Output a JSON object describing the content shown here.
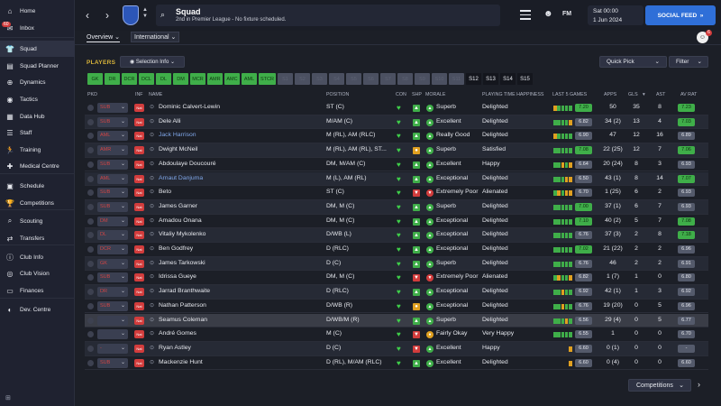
{
  "sidebar": {
    "items": [
      {
        "label": "Home",
        "icon": "home-icon",
        "glyph": "⌂"
      },
      {
        "label": "Inbox",
        "icon": "inbox-icon",
        "glyph": "✉",
        "badge": "60"
      },
      {
        "label": "Squad",
        "icon": "squad-icon",
        "glyph": "👕"
      },
      {
        "label": "Squad Planner",
        "icon": "planner-icon",
        "glyph": "▤"
      },
      {
        "label": "Dynamics",
        "icon": "dynamics-icon",
        "glyph": "⊕"
      },
      {
        "label": "Tactics",
        "icon": "tactics-icon",
        "glyph": "◉"
      },
      {
        "label": "Data Hub",
        "icon": "data-hub-icon",
        "glyph": "▦"
      },
      {
        "label": "Staff",
        "icon": "staff-icon",
        "glyph": "☰"
      },
      {
        "label": "Training",
        "icon": "training-icon",
        "glyph": "🏃"
      },
      {
        "label": "Medical Centre",
        "icon": "medical-icon",
        "glyph": "✚"
      },
      {
        "label": "Schedule",
        "icon": "schedule-icon",
        "glyph": "▣"
      },
      {
        "label": "Competitions",
        "icon": "trophy-icon",
        "glyph": "🏆"
      },
      {
        "label": "Scouting",
        "icon": "scouting-icon",
        "glyph": "⌕"
      },
      {
        "label": "Transfers",
        "icon": "transfers-icon",
        "glyph": "⇄"
      },
      {
        "label": "Club Info",
        "icon": "club-info-icon",
        "glyph": "ⓘ"
      },
      {
        "label": "Club Vision",
        "icon": "vision-icon",
        "glyph": "◎"
      },
      {
        "label": "Finances",
        "icon": "finances-icon",
        "glyph": "▭"
      },
      {
        "label": "Dev. Centre",
        "icon": "dev-centre-icon",
        "glyph": "◐"
      }
    ]
  },
  "header": {
    "title": "Squad",
    "subtitle": "2nd in Premier League - No fixture scheduled.",
    "time": "Sat 00:00",
    "date": "1 Jun 2024",
    "social_feed": "SOCIAL FEED",
    "fm_logo": "FM"
  },
  "subnav": {
    "overview": "Overview",
    "international": "International",
    "avatar_badge": "6"
  },
  "panel": {
    "players_label": "PLAYERS",
    "selection_info": "Selection Info",
    "quick_pick": "Quick Pick",
    "filter": "Filter",
    "competitions": "Competitions"
  },
  "position_filters": [
    {
      "label": "GK",
      "state": "green"
    },
    {
      "label": "DR",
      "state": "green"
    },
    {
      "label": "DCR",
      "state": "green"
    },
    {
      "label": "DCL",
      "state": "green"
    },
    {
      "label": "DL",
      "state": "green"
    },
    {
      "label": "DM",
      "state": "green"
    },
    {
      "label": "MCR",
      "state": "green"
    },
    {
      "label": "AMR",
      "state": "green"
    },
    {
      "label": "AMC",
      "state": "green"
    },
    {
      "label": "AML",
      "state": "green"
    },
    {
      "label": "STCR",
      "state": "green"
    },
    {
      "label": "S1",
      "state": "grey"
    },
    {
      "label": "S2",
      "state": "grey"
    },
    {
      "label": "S3",
      "state": "grey"
    },
    {
      "label": "S4",
      "state": "grey"
    },
    {
      "label": "S5",
      "state": "grey"
    },
    {
      "label": "S6",
      "state": "grey"
    },
    {
      "label": "S7",
      "state": "grey"
    },
    {
      "label": "S8",
      "state": "grey"
    },
    {
      "label": "S9",
      "state": "grey"
    },
    {
      "label": "S10",
      "state": "grey"
    },
    {
      "label": "S11",
      "state": "grey"
    },
    {
      "label": "S12",
      "state": "dark"
    },
    {
      "label": "S13",
      "state": "dark"
    },
    {
      "label": "S14",
      "state": "dark"
    },
    {
      "label": "S15",
      "state": "dark"
    }
  ],
  "table": {
    "columns": [
      "PKD",
      "INF",
      "NAME",
      "POSITION",
      "CON",
      "SHP",
      "MORALE",
      "PLAYING TIME HAPPINESS",
      "LAST 5 GAMES",
      "APPS",
      "GLS",
      "AST",
      "AV RAT"
    ],
    "rows": [
      {
        "pkd": "SUB",
        "name": "Dominic Calvert-Lewin",
        "link": false,
        "position": "ST (C)",
        "shp": "up",
        "morale_icon": "up",
        "morale": "Superb",
        "pth": "Delighted",
        "form": [
          "#e0a020",
          "#3fae49",
          "#3fae49",
          "#3fae49",
          "#3fae49"
        ],
        "last5": "7.20",
        "last5_color": "#3fae49",
        "apps": "50",
        "gls": "35",
        "ast": "8",
        "avrat": "7.23",
        "avrat_color": "#3fae49"
      },
      {
        "pkd": "SUB",
        "name": "Dele Alli",
        "link": false,
        "position": "M/AM (C)",
        "shp": "up",
        "morale_icon": "up",
        "morale": "Excellent",
        "pth": "Delighted",
        "form": [
          "#3fae49",
          "#3fae49",
          "#3fae49",
          "#3fae49",
          "#e0a020"
        ],
        "last5": "6.82",
        "last5_color": "#545a6b",
        "apps": "34 (2)",
        "gls": "13",
        "ast": "4",
        "avrat": "7.03",
        "avrat_color": "#3fae49"
      },
      {
        "pkd": "AML",
        "name": "Jack Harrison",
        "link": true,
        "position": "M (RL), AM (RLC)",
        "shp": "up",
        "morale_icon": "up",
        "morale": "Really Good",
        "pth": "Delighted",
        "form": [
          "#e0a020",
          "#3fae49",
          "#3fae49",
          "#3fae49",
          "#3fae49"
        ],
        "last5": "6.90",
        "last5_color": "#545a6b",
        "apps": "47",
        "gls": "12",
        "ast": "16",
        "avrat": "6.89",
        "avrat_color": "#545a6b"
      },
      {
        "pkd": "AMR",
        "name": "Dwight McNeil",
        "link": false,
        "position": "M (RL), AM (RL), ST...",
        "shp": "flat",
        "morale_icon": "up",
        "morale": "Superb",
        "pth": "Satisfied",
        "form": [
          "#3fae49",
          "#3fae49",
          "#3fae49",
          "#3fae49",
          "#3fae49"
        ],
        "last5": "7.08",
        "last5_color": "#3fae49",
        "apps": "22 (25)",
        "gls": "12",
        "ast": "7",
        "avrat": "7.06",
        "avrat_color": "#3fae49"
      },
      {
        "pkd": "SUB",
        "name": "Abdoulaye Doucouré",
        "link": false,
        "position": "DM, M/AM (C)",
        "shp": "up",
        "morale_icon": "up",
        "morale": "Excellent",
        "pth": "Happy",
        "form": [
          "#3fae49",
          "#3fae49",
          "#e0a020",
          "#3fae49",
          "#e0a020"
        ],
        "last5": "6.64",
        "last5_color": "#545a6b",
        "apps": "20 (24)",
        "gls": "8",
        "ast": "3",
        "avrat": "6.93",
        "avrat_color": "#545a6b"
      },
      {
        "pkd": "AML",
        "name": "Arnaut Danjuma",
        "link": true,
        "position": "M (L), AM (RL)",
        "shp": "up",
        "morale_icon": "up",
        "morale": "Exceptional",
        "pth": "Delighted",
        "form": [
          "#3fae49",
          "#3fae49",
          "#3fae49",
          "#e0a020",
          "#e0a020"
        ],
        "last5": "6.50",
        "last5_color": "#545a6b",
        "apps": "43 (1)",
        "gls": "8",
        "ast": "14",
        "avrat": "7.07",
        "avrat_color": "#3fae49"
      },
      {
        "pkd": "SUB",
        "name": "Beto",
        "link": false,
        "position": "ST (C)",
        "shp": "down",
        "morale_icon": "down",
        "morale": "Extremely Poor",
        "pth": "Alienated",
        "form": [
          "#3fae49",
          "#e0a020",
          "#3fae49",
          "#e0a020",
          "#e0a020"
        ],
        "last5": "6.70",
        "last5_color": "#545a6b",
        "apps": "1 (25)",
        "gls": "6",
        "ast": "2",
        "avrat": "6.93",
        "avrat_color": "#545a6b"
      },
      {
        "pkd": "SUB",
        "name": "James Garner",
        "link": false,
        "position": "DM, M (C)",
        "shp": "up",
        "morale_icon": "up",
        "morale": "Superb",
        "pth": "Delighted",
        "form": [
          "#3fae49",
          "#3fae49",
          "#3fae49",
          "#3fae49",
          "#3fae49"
        ],
        "last5": "7.00",
        "last5_color": "#3fae49",
        "apps": "37 (1)",
        "gls": "6",
        "ast": "7",
        "avrat": "6.93",
        "avrat_color": "#545a6b"
      },
      {
        "pkd": "DM",
        "name": "Amadou Onana",
        "link": false,
        "position": "DM, M (C)",
        "shp": "up",
        "morale_icon": "up",
        "morale": "Exceptional",
        "pth": "Delighted",
        "form": [
          "#3fae49",
          "#3fae49",
          "#3fae49",
          "#3fae49",
          "#3fae49"
        ],
        "last5": "7.10",
        "last5_color": "#3fae49",
        "apps": "40 (2)",
        "gls": "5",
        "ast": "7",
        "avrat": "7.08",
        "avrat_color": "#3fae49"
      },
      {
        "pkd": "DL",
        "name": "Vitaliy Mykolenko",
        "link": false,
        "position": "D/WB (L)",
        "shp": "up",
        "morale_icon": "up",
        "morale": "Exceptional",
        "pth": "Delighted",
        "form": [
          "#3fae49",
          "#3fae49",
          "#3fae49",
          "#3fae49",
          "#3fae49"
        ],
        "last5": "6.76",
        "last5_color": "#545a6b",
        "apps": "37 (3)",
        "gls": "2",
        "ast": "8",
        "avrat": "7.18",
        "avrat_color": "#3fae49"
      },
      {
        "pkd": "DCR",
        "name": "Ben Godfrey",
        "link": false,
        "position": "D (RLC)",
        "shp": "up",
        "morale_icon": "up",
        "morale": "Exceptional",
        "pth": "Delighted",
        "form": [
          "#3fae49",
          "#3fae49",
          "#3fae49",
          "#3fae49",
          "#3fae49"
        ],
        "last5": "7.02",
        "last5_color": "#3fae49",
        "apps": "21 (22)",
        "gls": "2",
        "ast": "2",
        "avrat": "6.96",
        "avrat_color": "#545a6b"
      },
      {
        "pkd": "GK",
        "name": "James Tarkowski",
        "link": false,
        "position": "D (C)",
        "shp": "up",
        "morale_icon": "up",
        "morale": "Superb",
        "pth": "Delighted",
        "form": [
          "#3fae49",
          "#3fae49",
          "#3fae49",
          "#3fae49",
          "#3fae49"
        ],
        "last5": "6.76",
        "last5_color": "#545a6b",
        "apps": "46",
        "gls": "2",
        "ast": "2",
        "avrat": "6.91",
        "avrat_color": "#545a6b"
      },
      {
        "pkd": "SUB",
        "name": "Idrissa Gueye",
        "link": false,
        "position": "DM, M (C)",
        "shp": "down",
        "morale_icon": "down",
        "morale": "Extremely Poor",
        "pth": "Alienated",
        "form": [
          "#3fae49",
          "#e0a020",
          "#3fae49",
          "#3fae49",
          "#e0a020"
        ],
        "last5": "6.82",
        "last5_color": "#545a6b",
        "apps": "1 (7)",
        "gls": "1",
        "ast": "0",
        "avrat": "6.80",
        "avrat_color": "#545a6b"
      },
      {
        "pkd": "DR",
        "name": "Jarrad Branthwaite",
        "link": false,
        "position": "D (RLC)",
        "shp": "up",
        "morale_icon": "up",
        "morale": "Exceptional",
        "pth": "Delighted",
        "form": [
          "#3fae49",
          "#3fae49",
          "#e0a020",
          "#3fae49",
          "#3fae49"
        ],
        "last5": "6.92",
        "last5_color": "#545a6b",
        "apps": "42 (1)",
        "gls": "1",
        "ast": "3",
        "avrat": "6.92",
        "avrat_color": "#545a6b"
      },
      {
        "pkd": "SUB",
        "name": "Nathan Patterson",
        "link": false,
        "position": "D/WB (R)",
        "shp": "flat",
        "morale_icon": "up",
        "morale": "Exceptional",
        "pth": "Delighted",
        "form": [
          "#3fae49",
          "#3fae49",
          "#e0a020",
          "#3fae49",
          "#3fae49"
        ],
        "last5": "6.76",
        "last5_color": "#545a6b",
        "apps": "19 (20)",
        "gls": "0",
        "ast": "5",
        "avrat": "6.96",
        "avrat_color": "#545a6b"
      },
      {
        "pkd": "",
        "name": "Seamus Coleman",
        "link": false,
        "position": "D/WB/M (R)",
        "shp": "up",
        "morale_icon": "up",
        "morale": "Superb",
        "pth": "Delighted",
        "form": [
          "#3fae49",
          "#3fae49",
          "#3fae49",
          "#e0a020",
          "#3fae49"
        ],
        "last5": "6.56",
        "last5_color": "#545a6b",
        "apps": "29 (4)",
        "gls": "0",
        "ast": "5",
        "avrat": "6.77",
        "avrat_color": "#545a6b",
        "highlight": true
      },
      {
        "pkd": "",
        "name": "André Gomes",
        "link": false,
        "position": "M (C)",
        "shp": "down",
        "morale_icon": "flat",
        "morale": "Fairly Okay",
        "pth": "Very Happy",
        "form": [
          "#3fae49",
          "#3fae49",
          "#3fae49",
          "#3fae49",
          "#3fae49"
        ],
        "last5": "6.55",
        "last5_color": "#545a6b",
        "apps": "1",
        "gls": "0",
        "ast": "0",
        "avrat": "6.70",
        "avrat_color": "#545a6b"
      },
      {
        "pkd": "-",
        "name": "Ryan Astley",
        "link": false,
        "position": "D (C)",
        "shp": "down",
        "morale_icon": "up",
        "morale": "Excellent",
        "pth": "Happy",
        "form": [
          "#e0a020"
        ],
        "last5": "6.60",
        "last5_color": "#545a6b",
        "apps": "0 (1)",
        "gls": "0",
        "ast": "0",
        "avrat": "-",
        "avrat_color": "#545a6b"
      },
      {
        "pkd": "SUB",
        "name": "Mackenzie Hunt",
        "link": false,
        "position": "D (RL), M/AM (RLC)",
        "shp": "up",
        "morale_icon": "up",
        "morale": "Excellent",
        "pth": "Delighted",
        "form": [
          "#e0a020"
        ],
        "last5": "6.60",
        "last5_color": "#545a6b",
        "apps": "0 (4)",
        "gls": "0",
        "ast": "0",
        "avrat": "6.60",
        "avrat_color": "#545a6b"
      }
    ]
  }
}
